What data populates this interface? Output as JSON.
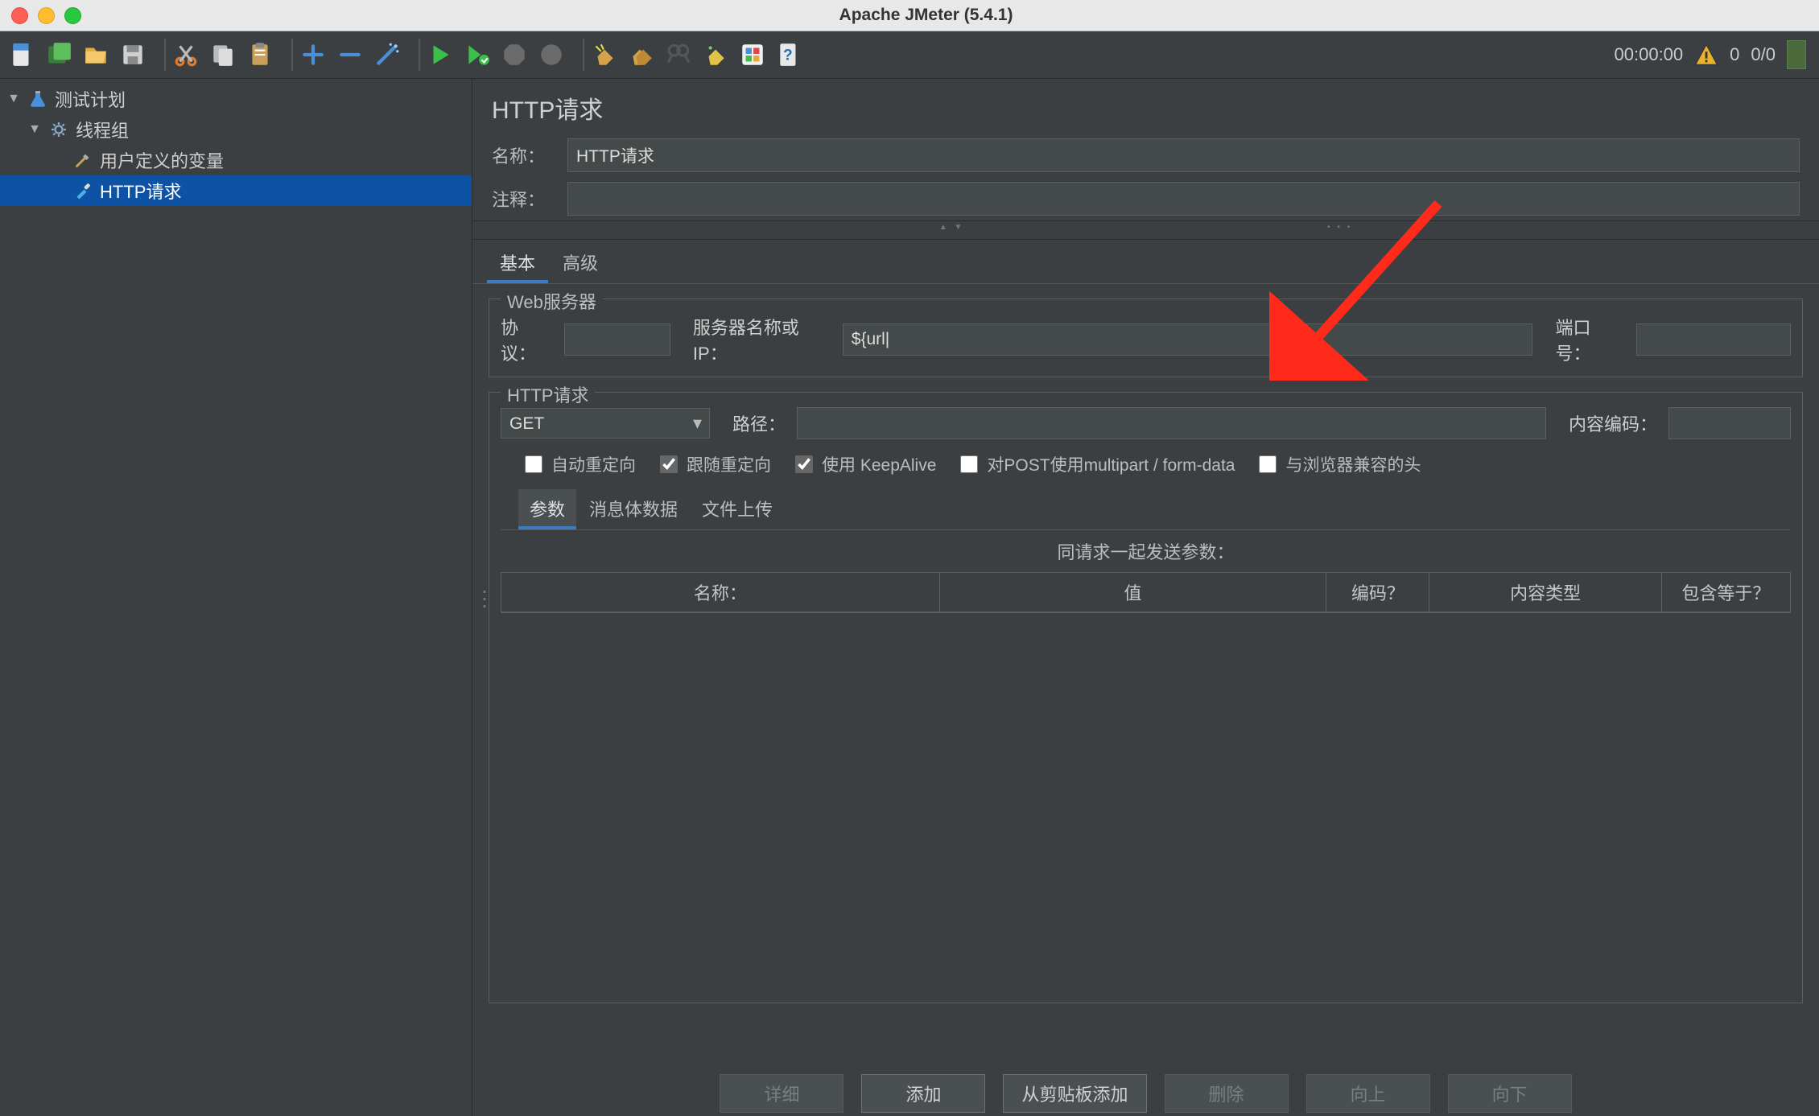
{
  "window": {
    "title": "Apache JMeter (5.4.1)"
  },
  "status": {
    "timer": "00:00:00",
    "warn_count": "0",
    "run_ratio": "0/0"
  },
  "tree": {
    "root": "测试计划",
    "thread_group": "线程组",
    "user_vars": "用户定义的变量",
    "http_req": "HTTP请求"
  },
  "panel": {
    "title": "HTTP请求",
    "name_label": "名称：",
    "name_value": "HTTP请求",
    "comment_label": "注释：",
    "comment_value": "",
    "tabs": {
      "basic": "基本",
      "advanced": "高级"
    },
    "web_server": {
      "legend": "Web服务器",
      "protocol_label": "协议：",
      "protocol_value": "",
      "server_label": "服务器名称或IP：",
      "server_value": "${url|",
      "port_label": "端口号：",
      "port_value": ""
    },
    "http_req": {
      "legend": "HTTP请求",
      "method": "GET",
      "path_label": "路径：",
      "path_value": "",
      "encoding_label": "内容编码：",
      "encoding_value": ""
    },
    "checks": {
      "auto_redirect": "自动重定向",
      "follow_redirect": "跟随重定向",
      "keepalive": "使用 KeepAlive",
      "multipart": "对POST使用multipart / form-data",
      "browser_headers": "与浏览器兼容的头"
    },
    "subtabs": {
      "params": "参数",
      "body": "消息体数据",
      "file": "文件上传"
    },
    "params_caption": "同请求一起发送参数：",
    "columns": {
      "name": "名称：",
      "value": "值",
      "encode": "编码？",
      "content_type": "内容类型",
      "include_equals": "包含等于？"
    },
    "buttons": {
      "detail": "详细",
      "add": "添加",
      "from_clipboard": "从剪贴板添加",
      "delete": "删除",
      "up": "向上",
      "down": "向下"
    }
  }
}
